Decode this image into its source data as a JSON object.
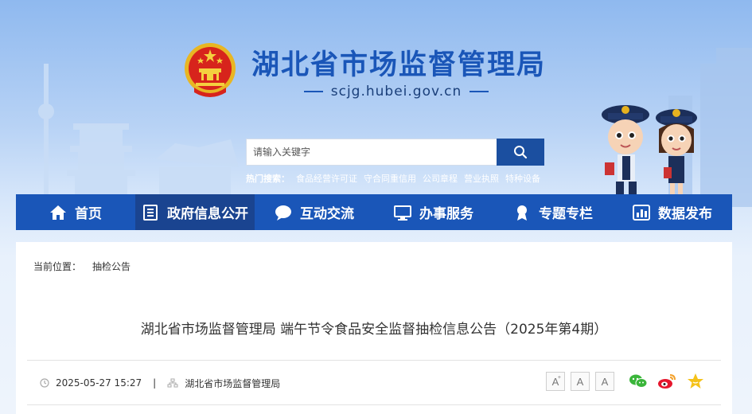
{
  "header": {
    "site_title": "湖北省市场监督管理局",
    "site_domain": "scjg.hubei.gov.cn"
  },
  "search": {
    "placeholder": "请输入关键字",
    "hot_label": "热门搜索：",
    "hot_terms": [
      "食品经营许可证",
      "守合同重信用",
      "公司章程",
      "营业执照",
      "特种设备"
    ]
  },
  "nav": {
    "items": [
      {
        "label": "首页",
        "icon": "home-icon"
      },
      {
        "label": "政府信息公开",
        "icon": "document-icon",
        "active": true
      },
      {
        "label": "互动交流",
        "icon": "chat-bubble-icon"
      },
      {
        "label": "办事服务",
        "icon": "monitor-icon"
      },
      {
        "label": "专题专栏",
        "icon": "award-icon"
      },
      {
        "label": "数据发布",
        "icon": "bar-chart-icon"
      }
    ]
  },
  "breadcrumb": {
    "prefix": "当前位置：",
    "current": "抽检公告"
  },
  "article": {
    "title": "湖北省市场监督管理局 端午节令食品安全监督抽检信息公告（2025年第4期）",
    "date": "2025-05-27 15:27",
    "separator": "|",
    "source": "湖北省市场监督管理局"
  },
  "font_controls": {
    "increase": "A",
    "normal": "A",
    "decrease": "A",
    "plus_mark": "+",
    "minus_mark": "-"
  },
  "share": [
    "wechat-icon",
    "weibo-icon",
    "favorite-star-icon"
  ],
  "colors": {
    "brand_blue": "#1a56b8",
    "nav_active": "#1a4490",
    "search_button": "#1b4fa0"
  }
}
